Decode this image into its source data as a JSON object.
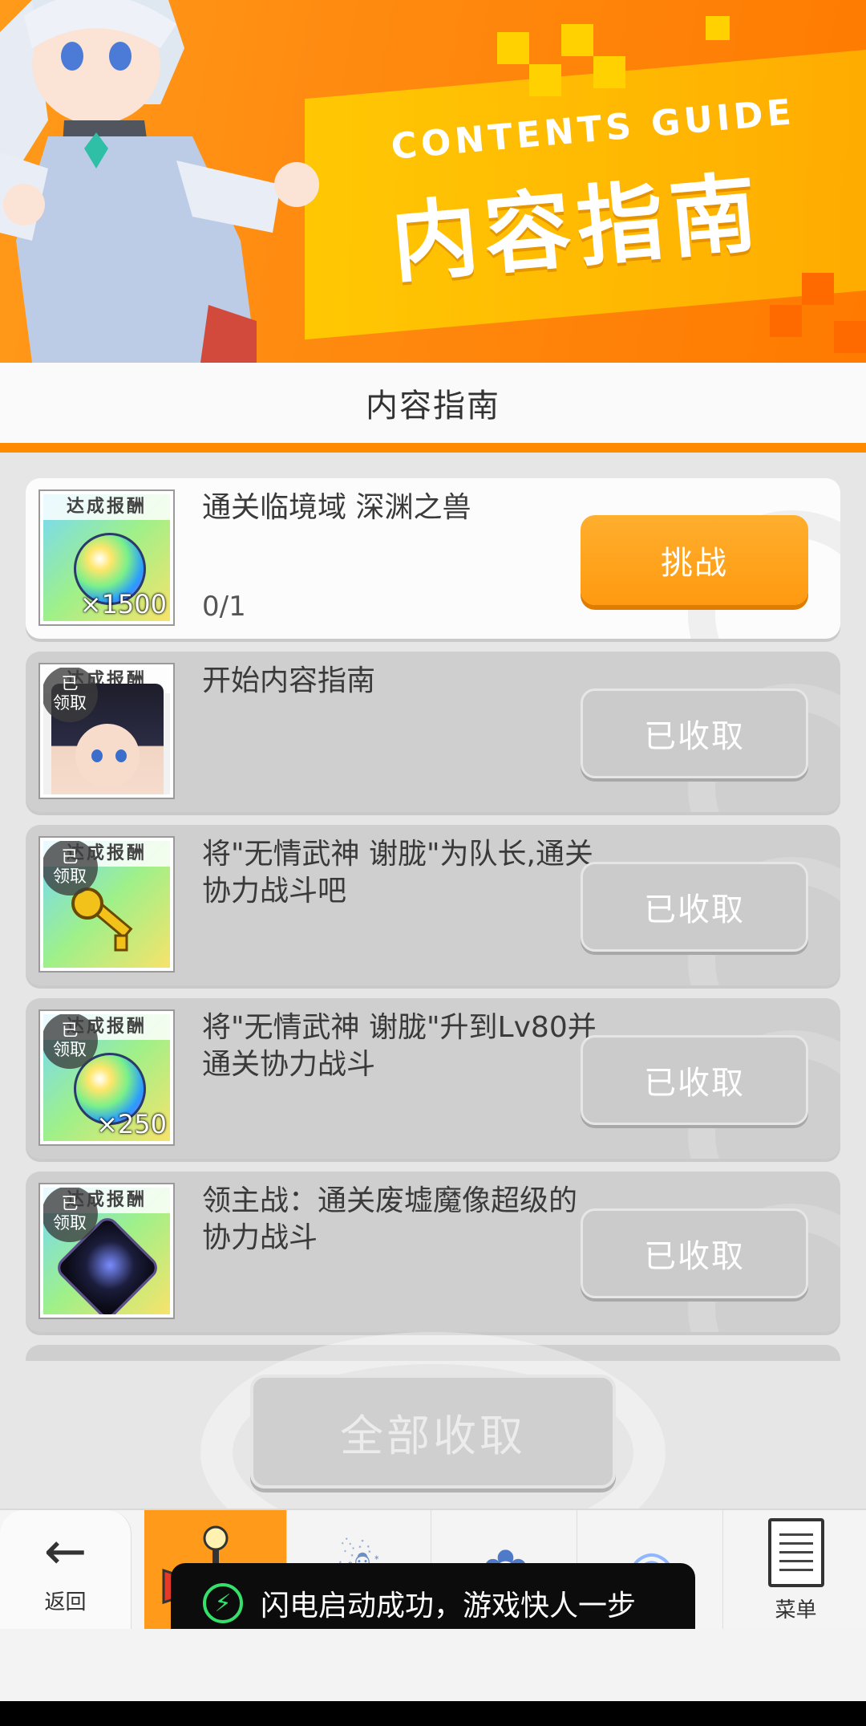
{
  "banner": {
    "title_en": "CONTENTS GUIDE",
    "title_zh": "内容指南"
  },
  "header": {
    "title": "内容指南"
  },
  "tasks": [
    {
      "reward_tag": "达成报酬",
      "reward_count": "×1500",
      "title": "通关临境域 深渊之兽",
      "progress": "0/1",
      "button": "挑战",
      "claimed_badge": ""
    },
    {
      "reward_tag": "达成报酬",
      "reward_count": "",
      "title": "开始内容指南",
      "progress": "",
      "button": "已收取",
      "claimed_badge": "已\n领取"
    },
    {
      "reward_tag": "达成报酬",
      "reward_count": "",
      "title": "将\"无情武神 谢胧\"为队长,通关协力战斗吧",
      "progress": "",
      "button": "已收取",
      "claimed_badge": "已\n领取"
    },
    {
      "reward_tag": "达成报酬",
      "reward_count": "×250",
      "title": "将\"无情武神 谢胧\"升到Lv80并通关协力战斗",
      "progress": "",
      "button": "已收取",
      "claimed_badge": "已\n领取"
    },
    {
      "reward_tag": "达成报酬",
      "reward_count": "",
      "title": "领主战：通关废墟魔像超级的协力战斗",
      "progress": "",
      "button": "已收取",
      "claimed_badge": "已\n领取"
    }
  ],
  "collect_all_button": "全部收取",
  "nav": {
    "back_label": "返回",
    "menu_label": "菜单"
  },
  "toast": {
    "text": "闪电启动成功，游戏快人一步"
  },
  "colors": {
    "accent": "#ff9a1a",
    "claimed_button": "#cbcbcb"
  }
}
